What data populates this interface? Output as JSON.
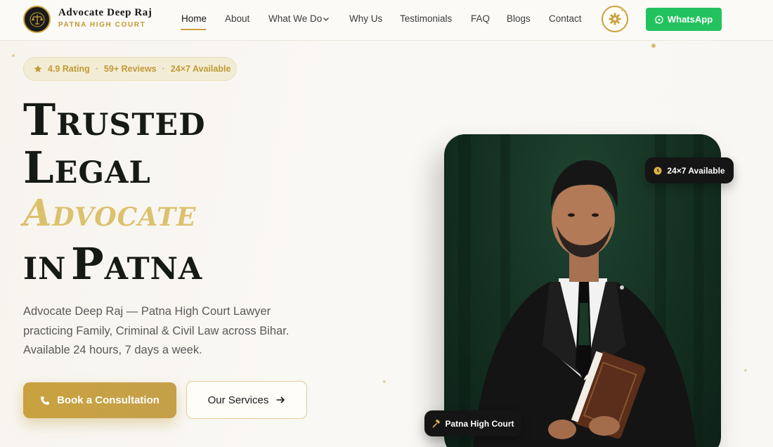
{
  "brand": {
    "name": "Advocate Deep Raj",
    "subtitle": "PATNA HIGH COURT"
  },
  "nav": {
    "items": [
      {
        "label": "Home",
        "active": true
      },
      {
        "label": "About"
      },
      {
        "label": "What We Do",
        "has_dropdown": true
      },
      {
        "label": "Why Us"
      },
      {
        "label": "Testimonials"
      },
      {
        "label": "FAQ"
      },
      {
        "label": "Blogs"
      },
      {
        "label": "Contact"
      }
    ],
    "theme_icon": "gear-icon",
    "whatsapp_label": "WhatsApp"
  },
  "rating_pill": {
    "rating": "4.9 Rating",
    "reviews": "59+ Reviews",
    "availability": "24×7 Available"
  },
  "hero": {
    "line1": "Trusted",
    "line2": "Legal",
    "line3": "Advocate",
    "line4_prefix": "in",
    "line4_city": "Patna",
    "description": [
      "Advocate Deep Raj — Patna High Court Lawyer",
      "practicing Family, Criminal & Civil Law across Bihar.",
      "Available 24 hours, 7 days a week."
    ],
    "primary_button": "Book a Consultation",
    "secondary_button": "Our Services"
  },
  "badges": {
    "availability": "24×7 Available",
    "court": "Patna High Court"
  },
  "colors": {
    "gold": "#c9a13b",
    "gold_light": "#dcc16d",
    "whatsapp": "#22c35e",
    "dark": "#151a14"
  }
}
